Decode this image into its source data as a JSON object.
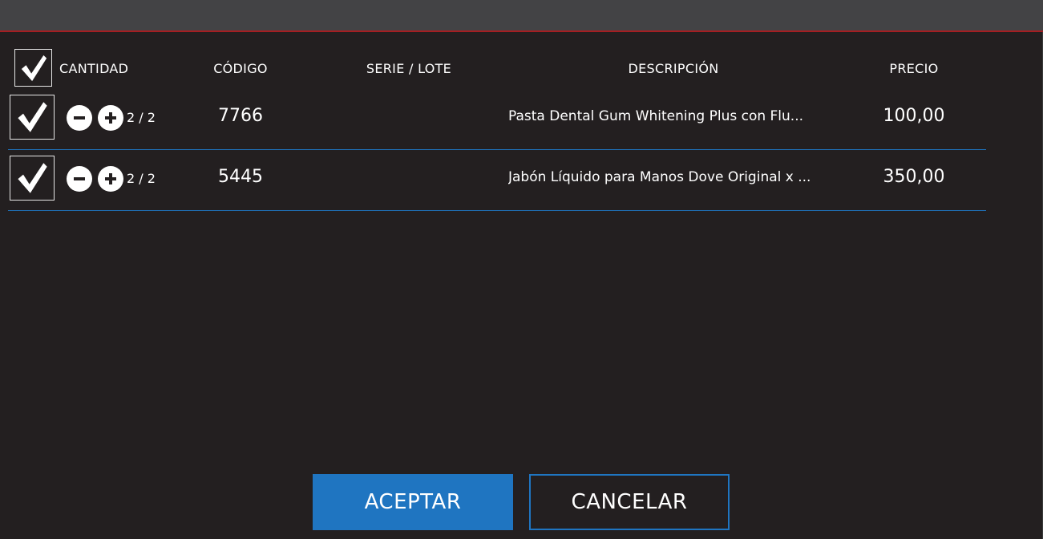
{
  "header": {
    "cantidad": "CANTIDAD",
    "codigo": "CÓDIGO",
    "serie_lote": "SERIE / LOTE",
    "descripcion": "DESCRIPCIÓN",
    "precio": "PRECIO",
    "select_all_checked": true
  },
  "rows": [
    {
      "checked": true,
      "quantity": "2 / 2",
      "code": "7766",
      "serie_lote": "",
      "description": "Pasta Dental Gum Whitening Plus con Flu...",
      "price": "100,00"
    },
    {
      "checked": true,
      "quantity": "2 / 2",
      "code": "5445",
      "serie_lote": "",
      "description": "Jabón Líquido para Manos Dove Original x ...",
      "price": "350,00"
    }
  ],
  "buttons": {
    "accept": "ACEPTAR",
    "cancel": "CANCELAR"
  },
  "colors": {
    "background": "#231f20",
    "titlebar": "#434345",
    "titlebar_accent": "#a51e22",
    "primary": "#1f75c1",
    "divider": "#1f6fb5"
  },
  "icons": {
    "check": "check-icon",
    "minus": "minus-icon",
    "plus": "plus-icon"
  }
}
